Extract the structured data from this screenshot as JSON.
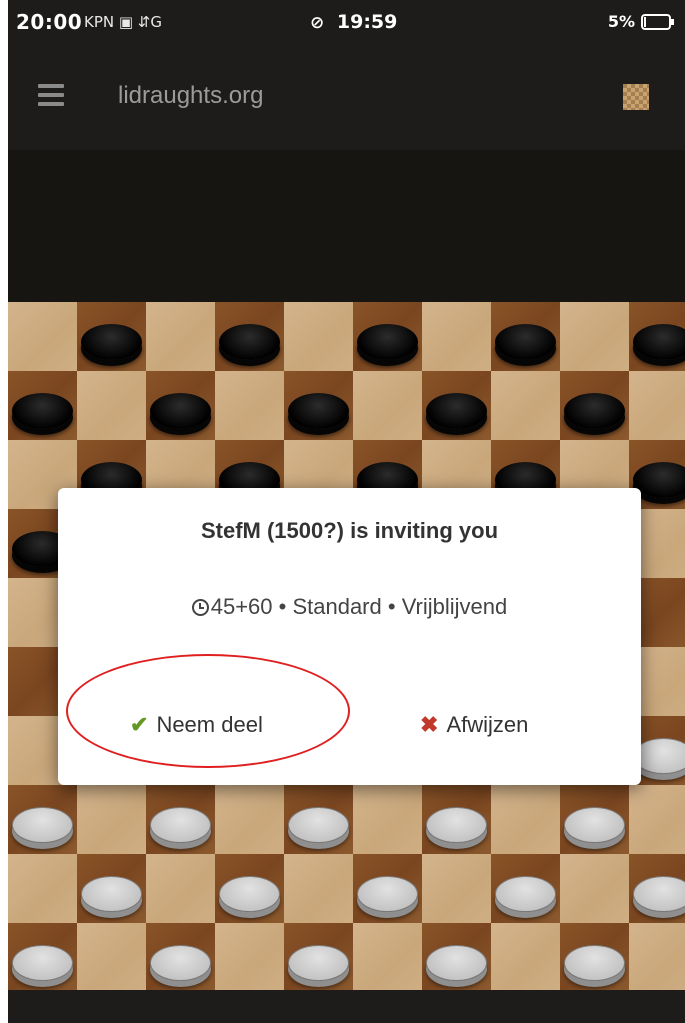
{
  "status_bar": {
    "time_left": "20:00",
    "left_extra": "KPN ▣ ⇵G",
    "link_glyph": "⊘",
    "time_center": "19:59",
    "battery_text": "5%",
    "battery_fraction": 0.05
  },
  "header": {
    "site_title": "lidraughts.org",
    "menu_icon": "hamburger-menu-icon",
    "board_icon": "board-theme-icon"
  },
  "board": {
    "rows": 10,
    "cols": 10,
    "black_rows": [
      0,
      1,
      2,
      3
    ],
    "white_rows": [
      6,
      7,
      8,
      9
    ]
  },
  "dialog": {
    "title": "StefM (1500?) is inviting you",
    "time_control": "45+60",
    "variant": "Standard",
    "mode": "Vrijblijvend",
    "separator": " • ",
    "accept_label": "Neem deel",
    "decline_label": "Afwijzen"
  },
  "colors": {
    "accept_check": "#629924",
    "decline_x": "#c0392b",
    "annotation_circle": "#e02020"
  }
}
